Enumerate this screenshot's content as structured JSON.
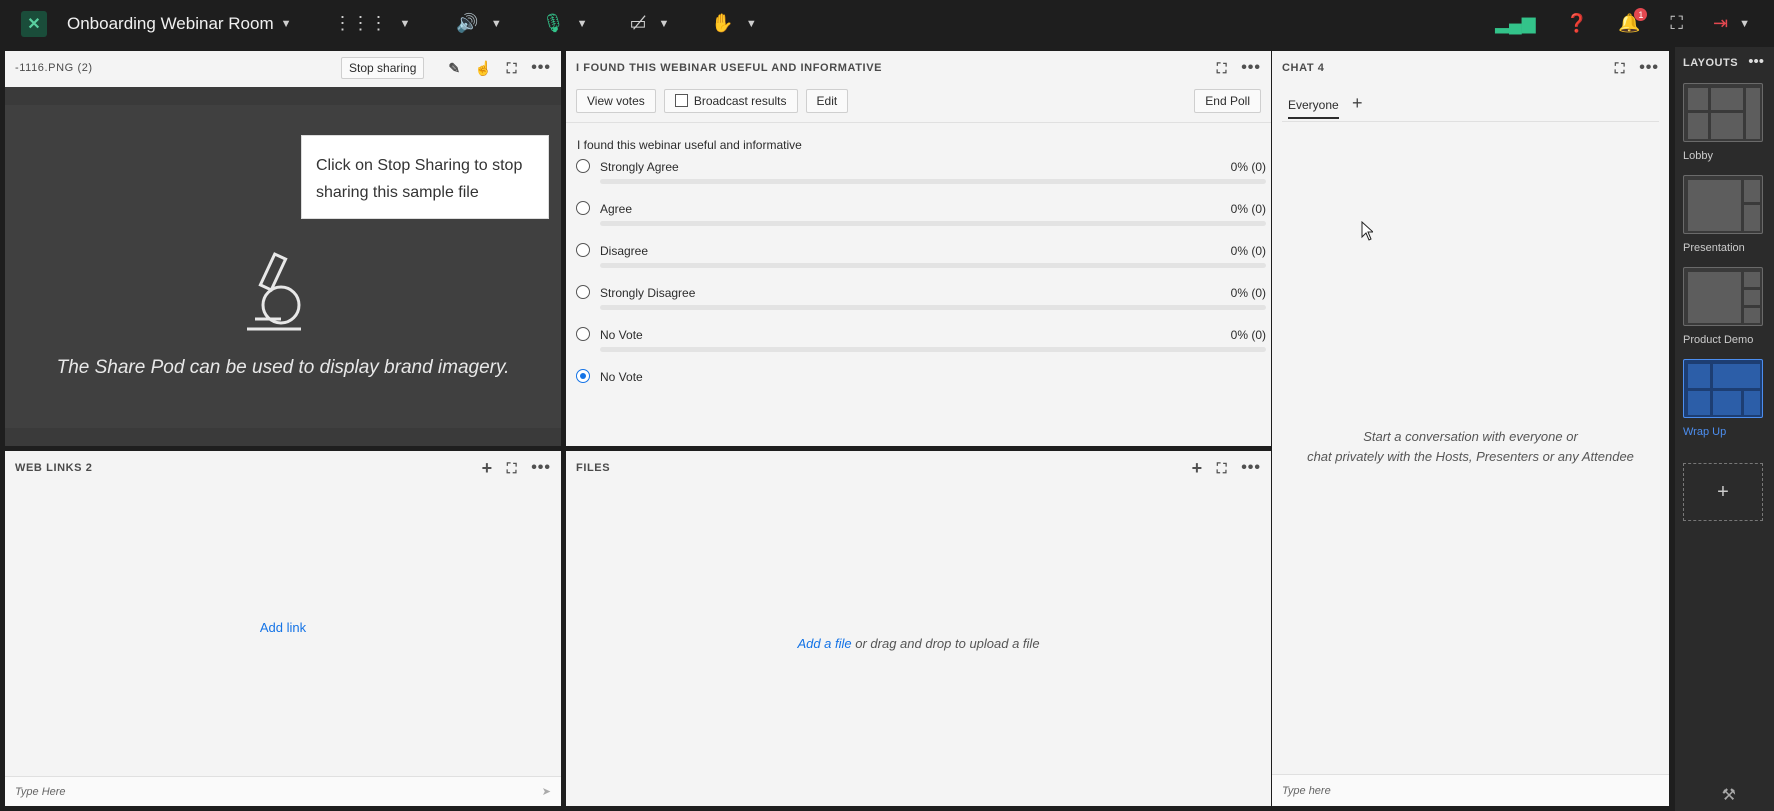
{
  "topbar": {
    "room_title": "Onboarding Webinar Room",
    "notification_count": "1",
    "icons": [
      "apps-grid-icon",
      "speaker-icon",
      "microphone-icon",
      "camera-off-icon",
      "raise-hand-icon",
      "network-icon",
      "help-icon",
      "bell-icon",
      "fullscreen-icon",
      "exit-icon"
    ]
  },
  "share_pod": {
    "title": "-1116.PNG (2)",
    "stop_label": "Stop sharing",
    "tooltip": "Click on Stop Sharing to stop sharing this sample file",
    "brand_text": "The Share Pod can be used to display brand imagery."
  },
  "poll_pod": {
    "title": "I FOUND THIS WEBINAR USEFUL AND INFORMATIVE",
    "buttons": {
      "view_votes": "View votes",
      "broadcast": "Broadcast results",
      "edit": "Edit",
      "end_poll": "End Poll"
    },
    "question": "I found this webinar useful and informative",
    "options": [
      {
        "label": "Strongly Agree",
        "pct": "0% (0)",
        "fraction": 0
      },
      {
        "label": "Agree",
        "pct": "0% (0)",
        "fraction": 0
      },
      {
        "label": "Disagree",
        "pct": "0% (0)",
        "fraction": 0
      },
      {
        "label": "Strongly Disagree",
        "pct": "0% (0)",
        "fraction": 0
      },
      {
        "label": "No Vote",
        "pct": "0% (0)",
        "fraction": 0
      }
    ],
    "my_vote": "No Vote"
  },
  "chat_pod": {
    "title": "CHAT 4",
    "tab": "Everyone",
    "empty_line1": "Start a conversation with everyone or",
    "empty_line2": "chat privately with the Hosts, Presenters or any Attendee",
    "input_placeholder": "Type here"
  },
  "weblinks_pod": {
    "title": "WEB LINKS 2",
    "add_link": "Add link",
    "input_placeholder": "Type Here"
  },
  "files_pod": {
    "title": "FILES",
    "add_file": "Add a file",
    "drop_text": " or drag and drop to upload a file"
  },
  "layouts": {
    "title": "LAYOUTS",
    "items": [
      {
        "label": "Lobby"
      },
      {
        "label": "Presentation"
      },
      {
        "label": "Product Demo"
      },
      {
        "label": "Wrap Up"
      }
    ]
  }
}
